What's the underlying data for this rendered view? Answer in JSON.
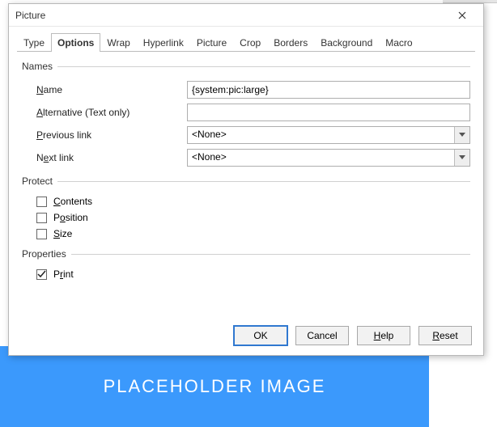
{
  "backdrop": {
    "label": "PLACEHOLDER IMAGE"
  },
  "dialog": {
    "title": "Picture",
    "tabs": [
      "Type",
      "Options",
      "Wrap",
      "Hyperlink",
      "Picture",
      "Crop",
      "Borders",
      "Background",
      "Macro"
    ],
    "active_tab": "Options",
    "groups": {
      "names": {
        "title": "Names",
        "name_label": "Name",
        "name_value": "{system:pic:large}",
        "alt_label": "Alternative (Text only)",
        "alt_value": "",
        "prev_label": "Previous link",
        "prev_value": "<None>",
        "next_label": "Next link",
        "next_value": "<None>"
      },
      "protect": {
        "title": "Protect",
        "contents_label": "Contents",
        "contents_checked": false,
        "position_label": "Position",
        "position_checked": false,
        "size_label": "Size",
        "size_checked": false
      },
      "properties": {
        "title": "Properties",
        "print_label": "Print",
        "print_checked": true
      }
    },
    "buttons": {
      "ok": "OK",
      "cancel": "Cancel",
      "help": "Help",
      "reset": "Reset"
    }
  }
}
